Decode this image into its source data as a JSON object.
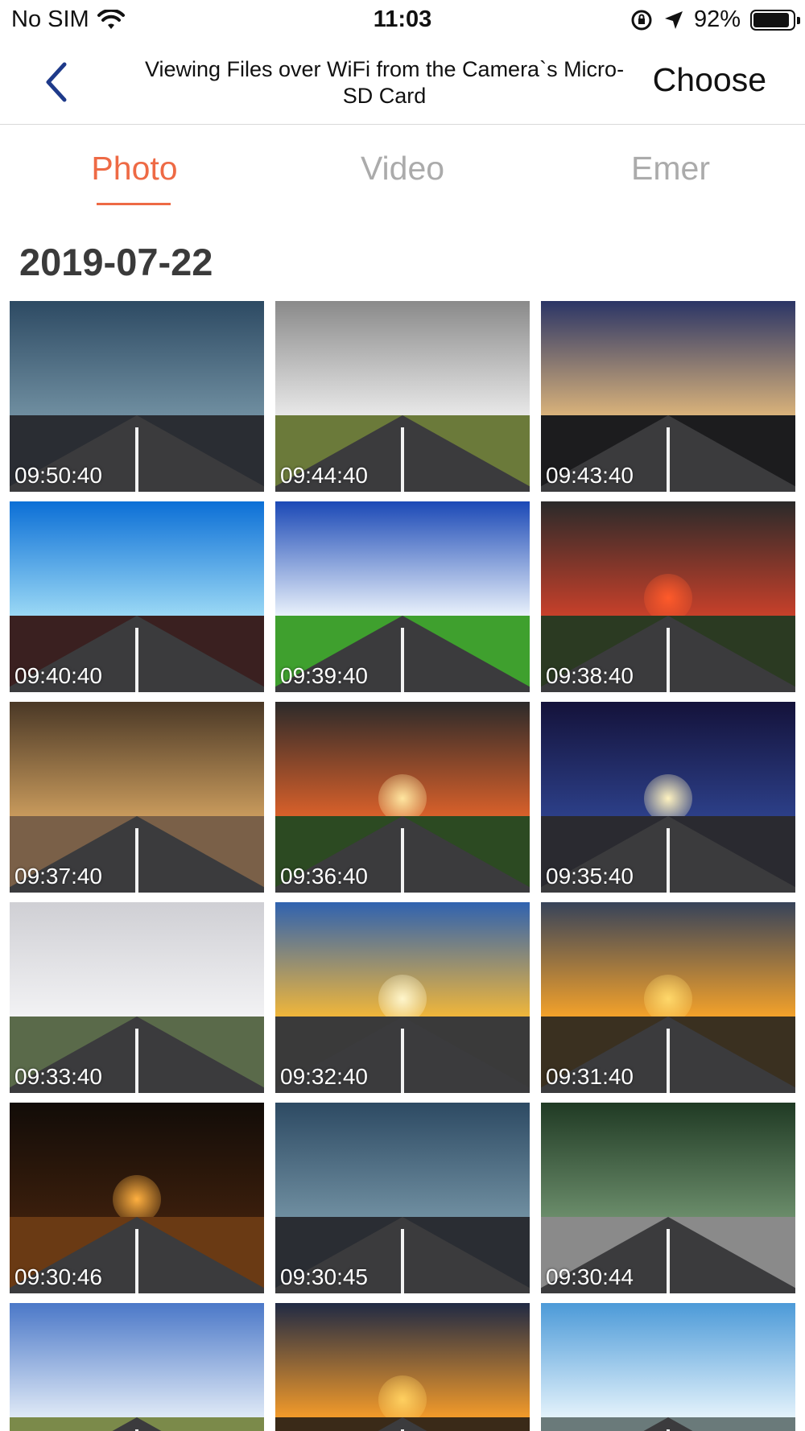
{
  "status_bar": {
    "carrier": "No SIM",
    "time": "11:03",
    "battery_percent": "92%",
    "battery_level": 0.92,
    "icons": [
      "wifi-icon",
      "orientation-lock-icon",
      "location-arrow-icon",
      "battery-icon"
    ]
  },
  "nav": {
    "title": "Viewing Files over WiFi from the Camera`s Micro-SD Card",
    "back_icon": "chevron-left-icon",
    "back_color": "#1e3a8a",
    "choose_label": "Choose"
  },
  "tabs": [
    {
      "label": "Photo",
      "active": true
    },
    {
      "label": "Video",
      "active": false
    },
    {
      "label": "Emer",
      "active": false
    }
  ],
  "accent_color": "#ee6a45",
  "date_heading": "2019-07-22",
  "photos": [
    {
      "time": "09:50:40",
      "sky": "linear-gradient(#2d4a63,#6f8ea0)",
      "ground": "#2a2d33",
      "sun": ""
    },
    {
      "time": "09:44:40",
      "sky": "linear-gradient(#8a8a8a,#e8e8e8)",
      "ground": "#6b7a3a",
      "sun": ""
    },
    {
      "time": "09:43:40",
      "sky": "linear-gradient(#2b3566,#d9b27a)",
      "ground": "#1c1c1e",
      "sun": ""
    },
    {
      "time": "09:40:40",
      "sky": "linear-gradient(#0b6fd6,#9ad8f5)",
      "ground": "#3a2020",
      "sun": ""
    },
    {
      "time": "09:39:40",
      "sky": "linear-gradient(#1b49b6,#e9f1fb)",
      "ground": "#3fa02e",
      "sun": ""
    },
    {
      "time": "09:38:40",
      "sky": "linear-gradient(#2a2a2a,#c7402a)",
      "ground": "#2b3a22",
      "sun": "#ff5a2a"
    },
    {
      "time": "09:37:40",
      "sky": "linear-gradient(#4a3826,#c89a5c)",
      "ground": "#7a6048",
      "sun": ""
    },
    {
      "time": "09:36:40",
      "sky": "linear-gradient(#2c2a2a,#d8602a)",
      "ground": "#2c4a22",
      "sun": "#ffe6a0"
    },
    {
      "time": "09:35:40",
      "sky": "linear-gradient(#14123a,#2c3f88)",
      "ground": "#2a2a30",
      "sun": "#fff3c0"
    },
    {
      "time": "09:33:40",
      "sky": "linear-gradient(#cfcfd4,#f2f2f4)",
      "ground": "#5a6a4a",
      "sun": ""
    },
    {
      "time": "09:32:40",
      "sky": "linear-gradient(#2f62b0,#f0b63a)",
      "ground": "#3a3a3a",
      "sun": "#fff6cc"
    },
    {
      "time": "09:31:40",
      "sky": "linear-gradient(#37435a,#f3a12a)",
      "ground": "#3a3020",
      "sun": "#ffd86a"
    },
    {
      "time": "09:30:46",
      "sky": "linear-gradient(#120c08,#3a1e0c)",
      "ground": "#6a3a14",
      "sun": "#ffb040"
    },
    {
      "time": "09:30:45",
      "sky": "linear-gradient(#2d4a63,#6f8ea0)",
      "ground": "#2a2d33",
      "sun": ""
    },
    {
      "time": "09:30:44",
      "sky": "linear-gradient(#203a24,#6a8c6a)",
      "ground": "#8a8a8a",
      "sun": ""
    },
    {
      "time": "",
      "sky": "linear-gradient(#4b78c8,#dfe9f6)",
      "ground": "#7b8a4a",
      "sun": ""
    },
    {
      "time": "",
      "sky": "linear-gradient(#202a44,#f29a2a)",
      "ground": "#3a2a18",
      "sun": "#ffd060"
    },
    {
      "time": "",
      "sky": "linear-gradient(#4c9ad8,#e3f2fb)",
      "ground": "#6a7a7a",
      "sun": ""
    }
  ]
}
